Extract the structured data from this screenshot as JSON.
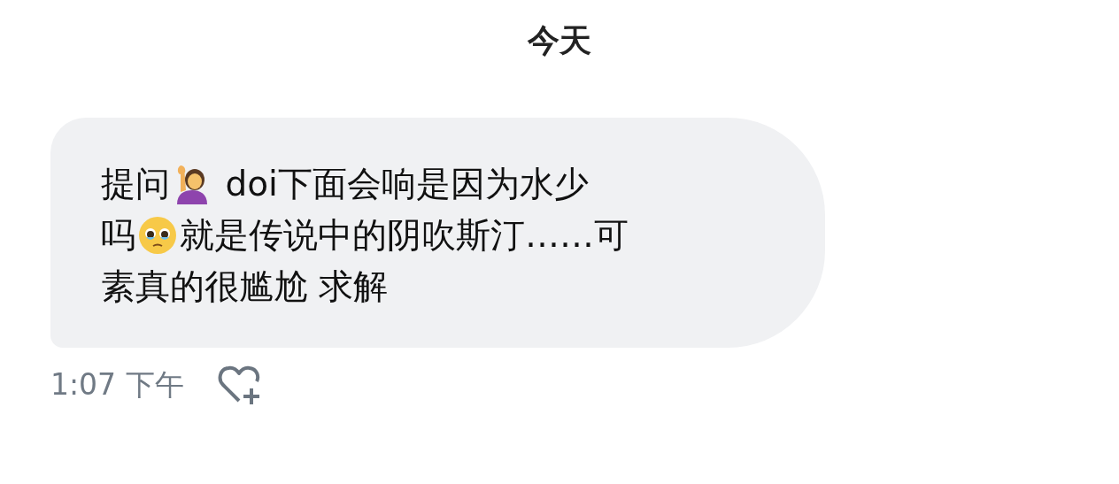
{
  "date_header": "今天",
  "message": {
    "lines": [
      [
        {
          "kind": "text",
          "text": "提问"
        },
        {
          "kind": "person"
        },
        {
          "kind": "text",
          "text": " doi下面会响是因为水少"
        }
      ],
      [
        {
          "kind": "text",
          "text": "吗"
        },
        {
          "kind": "face"
        },
        {
          "kind": "text",
          "text": "就是传说中的阴吹斯汀……可"
        }
      ],
      [
        {
          "kind": "text",
          "text": "素真的很尴尬 求解"
        }
      ]
    ],
    "time": "1:07 下午",
    "liked": false
  }
}
